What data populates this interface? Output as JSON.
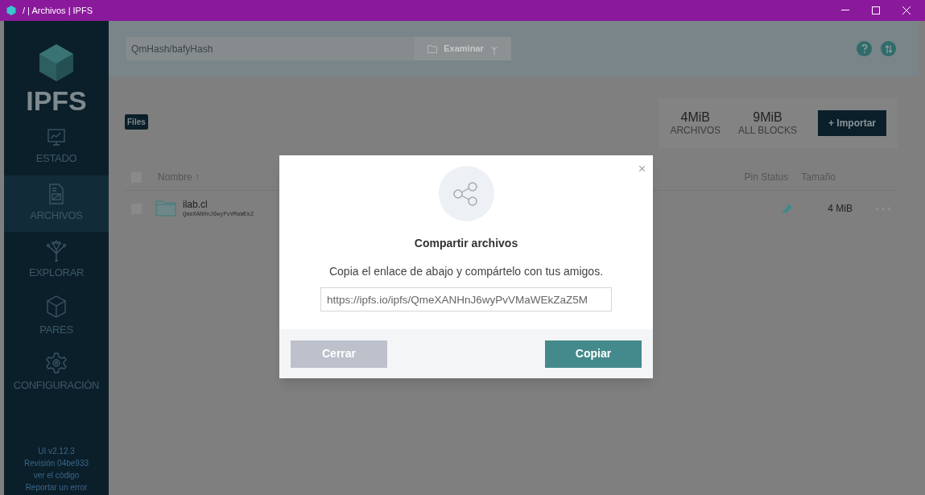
{
  "window": {
    "title": "/ | Archivos | IPFS"
  },
  "sidebar": {
    "logo_text": "IPFS",
    "items": [
      {
        "label": "ESTADO",
        "kind": "status",
        "selected": false
      },
      {
        "label": "ARCHIVOS",
        "kind": "files",
        "selected": true
      },
      {
        "label": "EXPLORAR",
        "kind": "explore",
        "selected": false
      },
      {
        "label": "PARES",
        "kind": "peers",
        "selected": false
      },
      {
        "label": "CONFIGURACIÓN",
        "kind": "settings",
        "selected": false
      }
    ],
    "footer": [
      "UI v2.12.3",
      "Revisión 04be933",
      "ver el código",
      "Reportar un error"
    ]
  },
  "topbar": {
    "search": {
      "placeholder": "QmHash/bafyHash"
    },
    "browse_button": "Examinar"
  },
  "breadcrumb": "Files",
  "stats": [
    {
      "value": "4MiB",
      "label": "ARCHIVOS"
    },
    {
      "value": "9MiB",
      "label": "ALL BLOCKS"
    }
  ],
  "import_button": "+ Importar",
  "table": {
    "all_checked": false,
    "columns": [
      "Nombre ↑",
      "Pin Status",
      "Tamaño"
    ],
    "rows": [
      {
        "name": "ilab.cl",
        "hash": "QmeXANHnJ6wyPvVMaWEkZ",
        "pinned": true,
        "size": "4 MiB",
        "checked": false
      }
    ]
  },
  "dialog": {
    "title": "Compartir archivos",
    "message": "Copia el enlace de abajo y compártelo con tus amigos.",
    "link": "https://ipfs.io/ipfs/QmeXANHnJ6wyPvVMaWEkZaZ5M",
    "buttons": [
      {
        "label": "Cerrar",
        "kind": "secondary"
      },
      {
        "label": "Copiar",
        "kind": "primary"
      }
    ]
  }
}
